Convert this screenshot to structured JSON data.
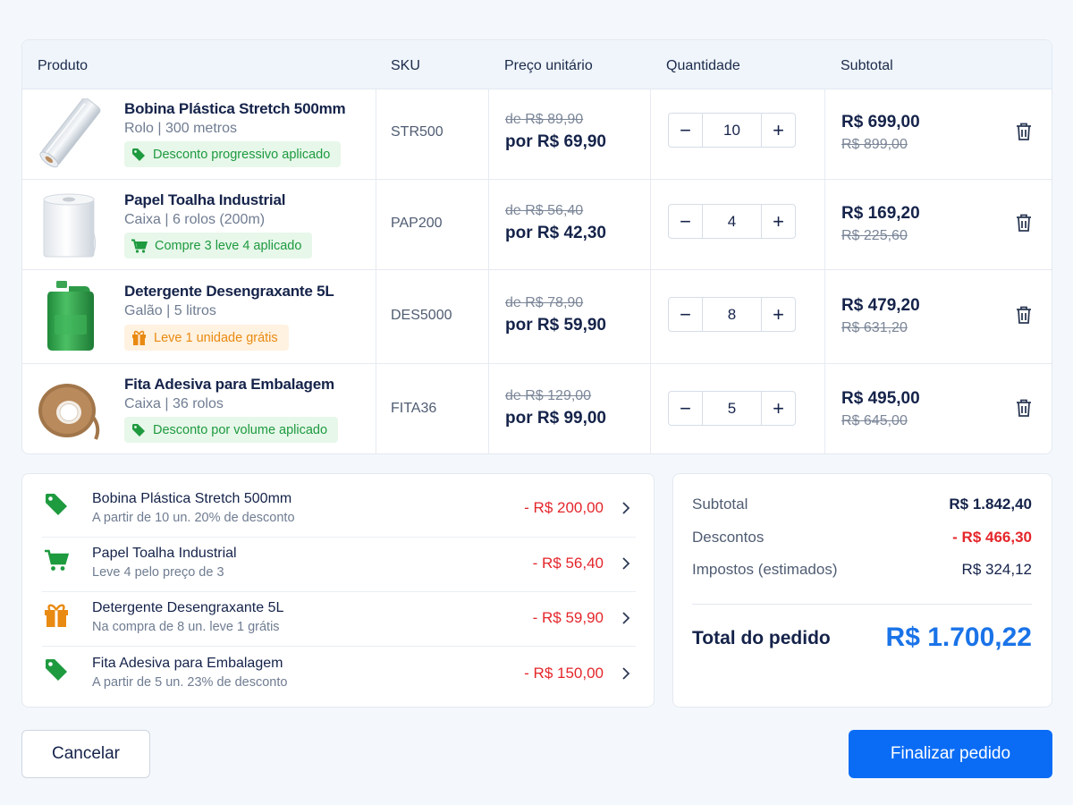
{
  "table": {
    "headers": {
      "product": "Produto",
      "sku": "SKU",
      "unit_price": "Preço unitário",
      "quantity": "Quantidade",
      "subtotal": "Subtotal"
    },
    "minus_symbol": "−",
    "plus_symbol": "+",
    "rows": [
      {
        "name": "Bobina Plástica Stretch 500mm",
        "desc": "Rolo | 300 metros",
        "badge": "Desconto progressivo aplicado",
        "badge_icon": "tag-icon",
        "sku": "STR500",
        "old_price": "de R$ 89,90",
        "new_price": "por R$ 69,90",
        "quantity": "10",
        "subtotal": "R$ 699,00",
        "subtotal_old": "R$ 899,00"
      },
      {
        "name": "Papel Toalha Industrial",
        "desc": "Caixa | 6 rolos (200m)",
        "badge": "Compre 3 leve 4 aplicado",
        "badge_icon": "cart-icon",
        "sku": "PAP200",
        "old_price": "de R$ 56,40",
        "new_price": "por R$ 42,30",
        "quantity": "4",
        "subtotal": "R$ 169,20",
        "subtotal_old": "R$ 225,60"
      },
      {
        "name": "Detergente Desengraxante 5L",
        "desc": "Galão | 5 litros",
        "badge": "Leve 1 unidade grátis",
        "badge_icon": "gift-icon",
        "sku": "DES5000",
        "old_price": "de R$ 78,90",
        "new_price": "por R$ 59,90",
        "quantity": "8",
        "subtotal": "R$ 479,20",
        "subtotal_old": "R$ 631,20"
      },
      {
        "name": "Fita Adesiva para Embalagem",
        "desc": "Caixa | 36 rolos",
        "badge": "Desconto por volume aplicado",
        "badge_icon": "tag-icon",
        "sku": "FITA36",
        "old_price": "de R$ 129,00",
        "new_price": "por R$ 99,00",
        "quantity": "5",
        "subtotal": "R$ 495,00",
        "subtotal_old": "R$ 645,00"
      }
    ]
  },
  "discounts": [
    {
      "title": "Bobina Plástica Stretch 500mm",
      "desc": "A partir de 10 un. 20% de desconto",
      "amount": "- R$ 200,00",
      "icon": "tag-icon"
    },
    {
      "title": "Papel Toalha Industrial",
      "desc": "Leve 4 pelo preço de 3",
      "amount": "- R$ 56,40",
      "icon": "cart-icon"
    },
    {
      "title": "Detergente Desengraxante 5L",
      "desc": "Na compra de 8 un. leve 1 grátis",
      "amount": "- R$ 59,90",
      "icon": "gift-icon"
    },
    {
      "title": "Fita Adesiva para Embalagem",
      "desc": "A partir de 5 un. 23% de desconto",
      "amount": "- R$ 150,00",
      "icon": "tag-icon"
    }
  ],
  "summary": {
    "subtotal_label": "Subtotal",
    "subtotal_value": "R$ 1.842,40",
    "discounts_label": "Descontos",
    "discounts_value": "- R$ 466,30",
    "taxes_label": "Impostos (estimados)",
    "taxes_value": "R$ 324,12",
    "total_label": "Total do pedido",
    "total_value": "R$ 1.700,22"
  },
  "actions": {
    "cancel": "Cancelar",
    "finish": "Finalizar pedido"
  },
  "colors": {
    "accent": "#0a6cf5",
    "total": "#1a73e8",
    "discount_red": "#e4262b",
    "badge_green": "#1e9a3f",
    "badge_orange": "#e98a12"
  }
}
